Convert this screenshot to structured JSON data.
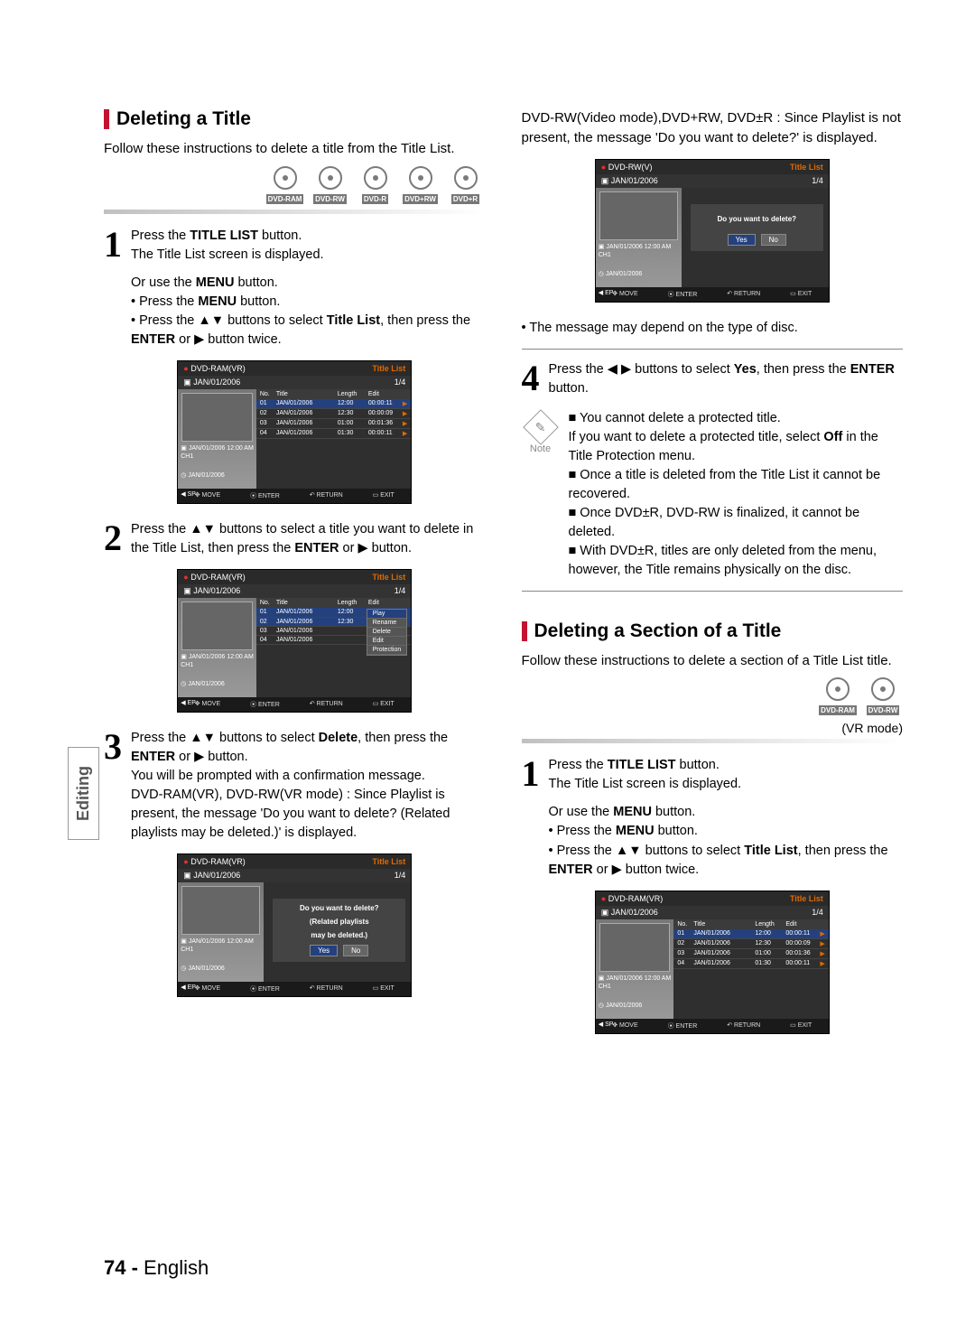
{
  "sideTab": "Editing",
  "footer": {
    "page": "74 -",
    "lang": "English"
  },
  "discs": [
    "DVD-RAM",
    "DVD-RW",
    "DVD-R",
    "DVD+RW",
    "DVD+R"
  ],
  "discs2": [
    "DVD-RAM",
    "DVD-RW"
  ],
  "sec1": {
    "title": "Deleting a Title",
    "intro": "Follow these instructions to delete a title from the Title List.",
    "step1a": "Press the ",
    "step1b": "TITLE LIST",
    "step1c": " button.",
    "step1d": "The Title List screen is displayed.",
    "or": "Or use the ",
    "menu": "MENU",
    "orEnd": " button.",
    "b1": "Press the ",
    "b1b": " button.",
    "b2a": "Press the ▲▼ buttons to select ",
    "b2b": "Title List",
    "b2c": ",  then press the ",
    "enter": "ENTER",
    "b2d": " or ▶ button twice.",
    "step2": "Press the ▲▼ buttons to select a title you want to delete in the Title List, then press the ",
    "step2b": " or ▶ button.",
    "step3a": "Press the ▲▼ buttons to select ",
    "step3del": "Delete",
    "step3b": ", then press the ",
    "step3c": " or ▶ button.",
    "step3d": "You will be prompted with a confirmation message.",
    "step3e": "DVD-RAM(VR), DVD-RW(VR mode) : Since Playlist is present, the message 'Do you want to delete? (Related playlists may be deleted.)' is displayed.",
    "step3f": "DVD-RW(Video mode),DVD+RW, DVD±R : Since Playlist is not present, the message 'Do you want to delete?' is displayed.",
    "depend": "The message may depend on the type of disc.",
    "step4a": "Press the ◀ ▶ buttons to select ",
    "yes": "Yes",
    "step4b": ", then press the ",
    "step4c": " button.",
    "note1a": "You cannot delete a protected title.",
    "note1b": "If you want to delete a protected title, select ",
    "off": "Off",
    "note1c": " in the Title Protection menu.",
    "note2": "Once a title is deleted from the Title List it cannot be recovered.",
    "note3": "Once DVD±R, DVD-RW is finalized, it cannot be deleted.",
    "note4": "With DVD±R, titles are only deleted from the menu, however, the Title remains physically on the disc."
  },
  "sec2": {
    "title": "Deleting a Section of a Title",
    "intro": "Follow these instructions to delete a section of a Title List title.",
    "vrmode": "(VR mode)"
  },
  "ss": {
    "vr": "DVD-RAM(VR)",
    "rw": "DVD-RW(V)",
    "tl": "Title List",
    "date": "JAN/01/2006",
    "pg": "1/4",
    "hdr": {
      "no": "No.",
      "title": "Title",
      "len": "Length",
      "edit": "Edit"
    },
    "rows": [
      {
        "no": "01",
        "ti": "JAN/01/2006",
        "len": "12:00",
        "ed": "00:00:11",
        "play": "▶"
      },
      {
        "no": "02",
        "ti": "JAN/01/2006",
        "len": "12:30",
        "ed": "00:00:09",
        "play": "▶"
      },
      {
        "no": "03",
        "ti": "JAN/01/2006",
        "len": "01:00",
        "ed": "00:01:36",
        "play": "▶"
      },
      {
        "no": "04",
        "ti": "JAN/01/2006",
        "len": "01:30",
        "ed": "00:00:11",
        "play": "▶"
      }
    ],
    "meta1": "JAN/01/2006 12:00 AM CH1",
    "meta2": "JAN/01/2006",
    "meta3": "SP",
    "meta3b": "EP",
    "ctx": [
      "Play",
      "Rename",
      "Delete",
      "Edit",
      "Protection"
    ],
    "dlg1": "Do you want to delete?",
    "dlg1b": "(Related playlists",
    "dlg1c": "may be deleted.)",
    "dlg2": "Do you want to delete?",
    "yes": "Yes",
    "no": "No",
    "foot": {
      "move": "MOVE",
      "enter": "ENTER",
      "ret": "RETURN",
      "exit": "EXIT"
    }
  },
  "note": "Note"
}
